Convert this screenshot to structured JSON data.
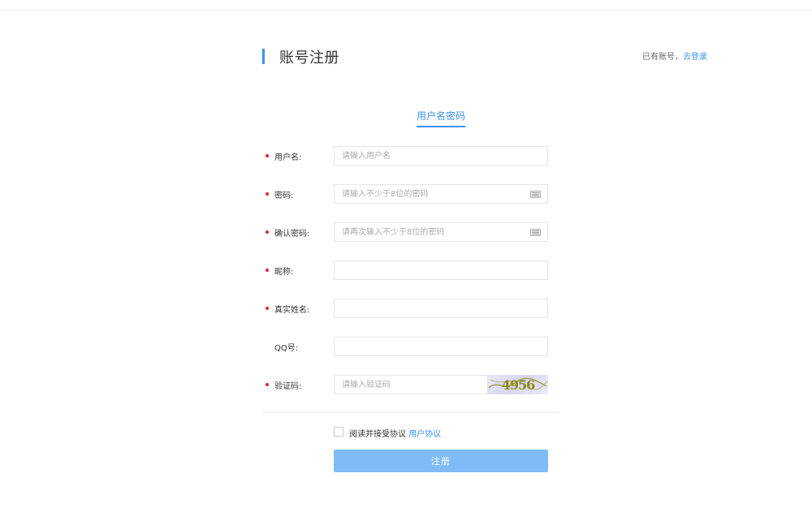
{
  "header": {
    "title": "账号注册",
    "login_hint_prefix": "已有账号，",
    "login_link": "去登录"
  },
  "tabs": [
    {
      "label": "用户名密码",
      "active": true
    }
  ],
  "form": {
    "fields": [
      {
        "label": "用户名:",
        "placeholder": "请输入用户名",
        "required": true
      },
      {
        "label": "密码:",
        "placeholder": "请输入不少于8位的密码",
        "required": true,
        "icon": "keyboard-icon"
      },
      {
        "label": "确认密码:",
        "placeholder": "请再次输入不少于8位的密码",
        "required": true,
        "icon": "keyboard-icon"
      },
      {
        "label": "昵称:",
        "placeholder": "",
        "required": true
      },
      {
        "label": "真实姓名:",
        "placeholder": "",
        "required": true
      },
      {
        "label": "QQ号:",
        "placeholder": "",
        "required": false
      },
      {
        "label": "验证码:",
        "placeholder": "请输入验证码",
        "required": true
      }
    ],
    "captcha_text": "4956",
    "agreement_prefix": "阅读并接受协议",
    "agreement_link": "用户协议",
    "submit_label": "注册"
  },
  "colors": {
    "accent": "#3b94f0",
    "required_dot": "#d9272b",
    "button_bg": "#7fbcf7"
  }
}
